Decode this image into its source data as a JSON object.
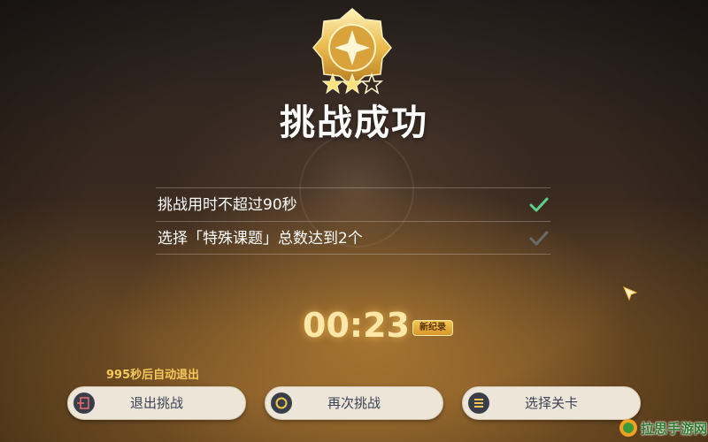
{
  "result": {
    "title": "挑战成功",
    "stars_earned": 2,
    "stars_total": 3
  },
  "conditions": [
    {
      "text": "挑战用时不超过90秒",
      "completed": true,
      "check_color": "#5fd08a"
    },
    {
      "text": "选择「特殊课题」总数达到2个",
      "completed": true,
      "check_color": "#6b6b6b"
    }
  ],
  "timer": {
    "value": "00:23",
    "record_label": "新纪录"
  },
  "auto_exit": {
    "text": "995秒后自动退出"
  },
  "buttons": {
    "exit": {
      "label": "退出挑战",
      "icon": "exit-door-icon"
    },
    "retry": {
      "label": "再次挑战",
      "icon": "ring-icon"
    },
    "select": {
      "label": "选择关卡",
      "icon": "menu-list-icon"
    }
  },
  "watermark": {
    "text": "拉思手游网"
  },
  "colors": {
    "gold": "#f5c85a",
    "timer": "#ffe7a8",
    "button_bg": "#ece5d8",
    "button_text": "#3b4255"
  }
}
